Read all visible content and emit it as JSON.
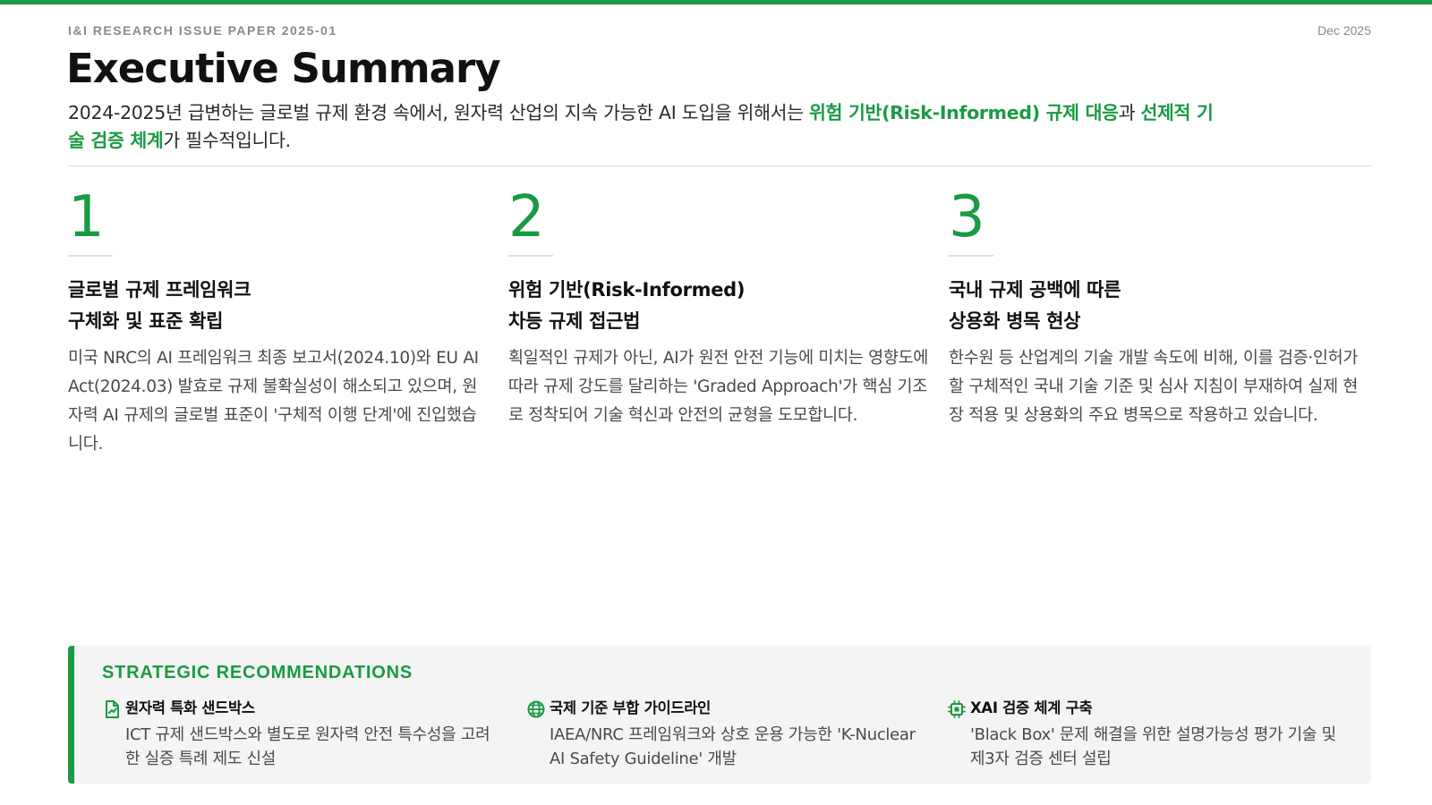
{
  "theme": {
    "accent": "#1a9a44"
  },
  "header": {
    "series": "I&I RESEARCH ISSUE PAPER 2025-01",
    "date": "Dec 2025",
    "title": "Executive Summary"
  },
  "summary": {
    "part1": "2024-2025년 급변하는 글로벌 규제 환경 속에서, 원자력 산업의 지속 가능한 AI 도입을 위해서는 ",
    "highlight1": "위험 기반(Risk-Informed) 규제 대응",
    "part2": "과 ",
    "highlight2": "선제적 기술 검증 체계",
    "part3": "가 필수적입니다."
  },
  "findings": [
    {
      "number": "1",
      "heading_line1": "글로벌 규제 프레임워크",
      "heading_line2": "구체화 및 표준 확립",
      "body": "미국 NRC의 AI 프레임워크 최종 보고서(2024.10)와 EU AI Act(2024.03) 발효로 규제 불확실성이 해소되고 있으며, 원자력 AI 규제의 글로벌 표준이 '구체적 이행 단계'에 진입했습니다."
    },
    {
      "number": "2",
      "heading_line1": "위험 기반(Risk-Informed)",
      "heading_line2": "차등 규제 접근법",
      "body": "획일적인 규제가 아닌, AI가 원전 안전 기능에 미치는 영향도에 따라 규제 강도를 달리하는 'Graded Approach'가 핵심 기조로 정착되어 기술 혁신과 안전의 균형을 도모합니다."
    },
    {
      "number": "3",
      "heading_line1": "국내 규제 공백에 따른",
      "heading_line2": "상용화 병목 현상",
      "body": "한수원 등 산업계의 기술 개발 속도에 비해, 이를 검증·인허가할 구체적인 국내 기술 기준 및 심사 지침이 부재하여 실제 현장 적용 및 상용화의 주요 병목으로 작용하고 있습니다."
    }
  ],
  "recommendations": {
    "title": "STRATEGIC RECOMMENDATIONS",
    "items": [
      {
        "icon": "sandbox-document-icon",
        "heading": "원자력 특화 샌드박스",
        "body": "ICT 규제 샌드박스와 별도로 원자력 안전 특수성을 고려한 실증 특례 제도 신설"
      },
      {
        "icon": "globe-icon",
        "heading": "국제 기준 부합 가이드라인",
        "body": "IAEA/NRC 프레임워크와 상호 운용 가능한 'K-Nuclear AI Safety Guideline' 개발"
      },
      {
        "icon": "chip-icon",
        "heading": "XAI 검증 체계 구축",
        "body": "'Black Box' 문제 해결을 위한 설명가능성 평가 기술 및 제3자 검증 센터 설립"
      }
    ]
  }
}
